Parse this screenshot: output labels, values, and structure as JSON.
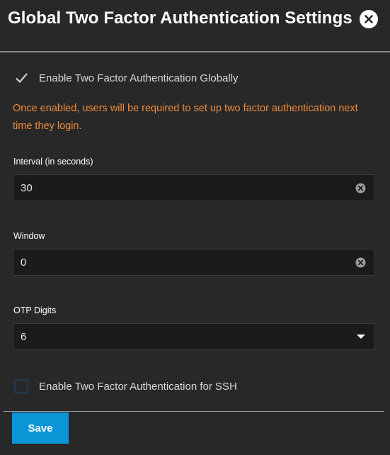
{
  "dialog": {
    "title": "Global Two Factor Authentication Settings",
    "close_icon": "close-circle-icon"
  },
  "enable_global": {
    "label": "Enable Two Factor Authentication Globally",
    "checked": true
  },
  "warning_text": "Once enabled, users will be required to set up two factor authentication next time they login.",
  "interval": {
    "label": "Interval (in seconds)",
    "value": "30"
  },
  "window": {
    "label": "Window",
    "value": "0"
  },
  "otp_digits": {
    "label": "OTP Digits",
    "value": "6"
  },
  "enable_ssh": {
    "label": "Enable Two Factor Authentication for SSH",
    "checked": false
  },
  "actions": {
    "save_label": "Save"
  },
  "colors": {
    "background": "#282828",
    "warning": "#ef8a3a",
    "primary_button": "#0a95d7",
    "input_background": "#1b1b1b"
  }
}
